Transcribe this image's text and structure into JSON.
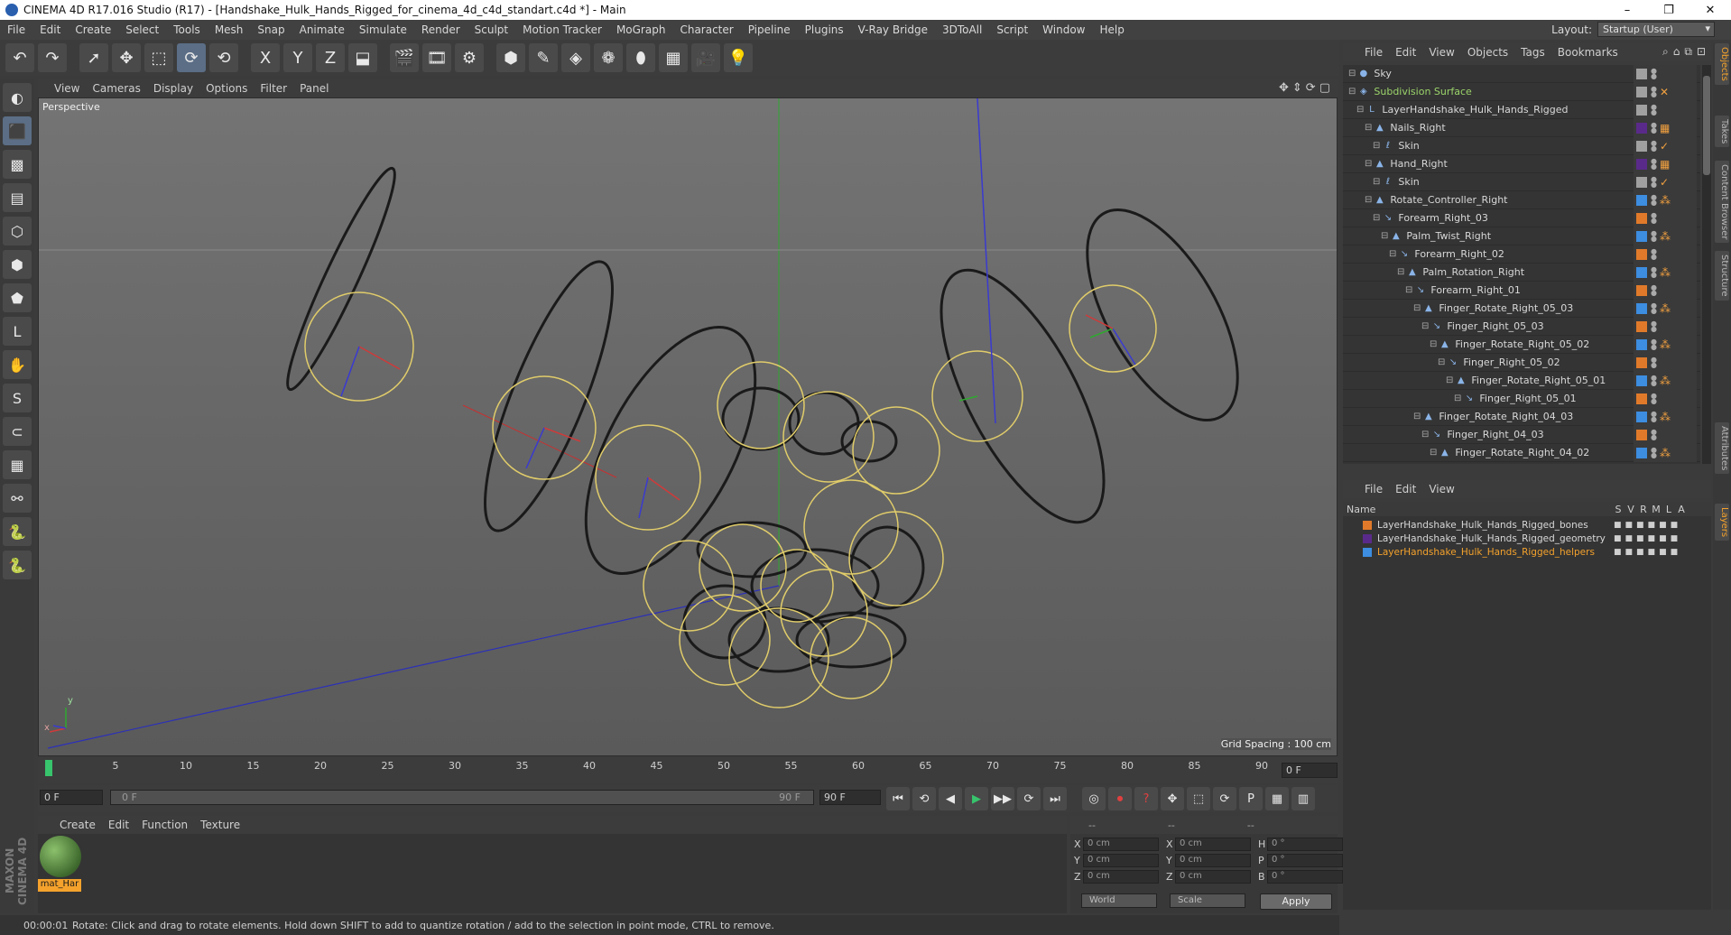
{
  "window": {
    "title": "CINEMA 4D R17.016 Studio (R17) - [Handshake_Hulk_Hands_Rigged_for_cinema_4d_c4d_standart.c4d *] - Main",
    "buttons": [
      "–",
      "❐",
      "✕"
    ]
  },
  "menubar": {
    "items": [
      "File",
      "Edit",
      "Create",
      "Select",
      "Tools",
      "Mesh",
      "Snap",
      "Animate",
      "Simulate",
      "Render",
      "Sculpt",
      "Motion Tracker",
      "MoGraph",
      "Character",
      "Pipeline",
      "Plugins",
      "V-Ray Bridge",
      "3DToAll",
      "Script",
      "Window",
      "Help"
    ],
    "layout_label": "Layout:",
    "layout_value": "Startup (User)"
  },
  "toolbar": {
    "icons": [
      "undo-icon",
      "redo-icon",
      "select-icon",
      "move-icon",
      "scale-icon",
      "rotate-icon",
      "recent-tool-icon",
      "x-axis-icon",
      "y-axis-icon",
      "z-axis-icon",
      "coord-system-icon",
      "render-view-icon",
      "render-picture-viewer-icon",
      "render-settings-icon",
      "cube-icon",
      "pen-icon",
      "subdivision-icon",
      "cloner-icon",
      "deformer-icon",
      "floor-icon",
      "camera-icon",
      "light-icon"
    ],
    "glyphs": [
      "↶",
      "↷",
      "➚",
      "✥",
      "⬚",
      "⟳",
      "⟲",
      "X",
      "Y",
      "Z",
      "⬓",
      "🎬",
      "🎞",
      "⚙",
      "⬢",
      "✎",
      "◈",
      "❁",
      "⬮",
      "▦",
      "🎥",
      "💡"
    ]
  },
  "lefttools": {
    "icons": [
      "make-editable-icon",
      "model-mode-icon",
      "texture-mode-icon",
      "workplane-icon",
      "points-mode-icon",
      "edges-mode-icon",
      "polygons-mode-icon",
      "axis-mode-icon",
      "tweak-icon",
      "solo-icon",
      "magnet-icon",
      "snap-icon",
      "lock-workplane-icon",
      "python-icon",
      "python-icon-2"
    ],
    "glyphs": [
      "◐",
      "⬛",
      "▩",
      "▤",
      "⬡",
      "⬢",
      "⬟",
      "L",
      "✋",
      "S",
      "⊂",
      "▦",
      "⚯",
      "🐍",
      "🐍"
    ],
    "logo": "MAXON CINEMA 4D"
  },
  "viewport": {
    "menu": [
      "View",
      "Cameras",
      "Display",
      "Options",
      "Filter",
      "Panel"
    ],
    "nav_icons": [
      "✥",
      "⇕",
      "⟳",
      "▢"
    ],
    "label": "Perspective",
    "grid_spacing": "Grid Spacing : 100 cm",
    "axis_x": "x",
    "axis_y": "y"
  },
  "timeline": {
    "ticks": [
      "0",
      "5",
      "10",
      "15",
      "20",
      "25",
      "30",
      "35",
      "40",
      "45",
      "50",
      "55",
      "60",
      "65",
      "70",
      "75",
      "80",
      "85",
      "90"
    ],
    "current_frame": "0 F"
  },
  "playback": {
    "start": "0 F",
    "range_start": "0 F",
    "range_end": "90 F",
    "end": "90 F",
    "buttons": [
      "⏮",
      "⟲",
      "◀",
      "▶",
      "▶▶",
      "⟳",
      "⏭"
    ],
    "key_buttons": [
      "◎",
      "⏺",
      "?",
      "✥",
      "⬚",
      "⟳",
      "P",
      "▦",
      "▥"
    ]
  },
  "material_manager": {
    "menu": [
      "Create",
      "Edit",
      "Function",
      "Texture"
    ],
    "material_name": "mat_Har"
  },
  "coordinates": {
    "head": [
      "--",
      "--",
      "--"
    ],
    "rows": [
      {
        "a": "X",
        "av": "0 cm",
        "b": "X",
        "bv": "0 cm",
        "c": "H",
        "cv": "0 °"
      },
      {
        "a": "Y",
        "av": "0 cm",
        "b": "Y",
        "bv": "0 cm",
        "c": "P",
        "cv": "0 °"
      },
      {
        "a": "Z",
        "av": "0 cm",
        "b": "Z",
        "bv": "0 cm",
        "c": "B",
        "cv": "0 °"
      }
    ],
    "world": "World",
    "scale": "Scale",
    "apply": "Apply"
  },
  "status": {
    "time": "00:00:01",
    "message": "Rotate: Click and drag to rotate elements. Hold down SHIFT to add to quantize rotation / add to the selection in point mode, CTRL to remove."
  },
  "object_manager": {
    "menu": [
      "File",
      "Edit",
      "View",
      "Objects",
      "Tags",
      "Bookmarks"
    ],
    "objects": [
      {
        "name": "Sky",
        "indent": 0,
        "icon": "●",
        "green": false,
        "swatch": "#a0a0a0",
        "tag": ""
      },
      {
        "name": "Subdivision Surface",
        "indent": 0,
        "icon": "◈",
        "green": true,
        "swatch": "#a0a0a0",
        "tag": "✕"
      },
      {
        "name": "LayerHandshake_Hulk_Hands_Rigged",
        "indent": 1,
        "icon": "L",
        "green": false,
        "swatch": "#a0a0a0",
        "tag": ""
      },
      {
        "name": "Nails_Right",
        "indent": 2,
        "icon": "▲",
        "green": false,
        "swatch": "#5a2a8a",
        "tag": "▦"
      },
      {
        "name": "Skin",
        "indent": 3,
        "icon": "ℓ",
        "green": false,
        "swatch": "#a0a0a0",
        "tag": "✓"
      },
      {
        "name": "Hand_Right",
        "indent": 2,
        "icon": "▲",
        "green": false,
        "swatch": "#5a2a8a",
        "tag": "▦"
      },
      {
        "name": "Skin",
        "indent": 3,
        "icon": "ℓ",
        "green": false,
        "swatch": "#a0a0a0",
        "tag": "✓"
      },
      {
        "name": "Rotate_Controller_Right",
        "indent": 2,
        "icon": "▲",
        "green": false,
        "swatch": "#3d8de0",
        "tag": "⁂"
      },
      {
        "name": "Forearm_Right_03",
        "indent": 3,
        "icon": "↘",
        "green": false,
        "swatch": "#e07a2a",
        "tag": ""
      },
      {
        "name": "Palm_Twist_Right",
        "indent": 4,
        "icon": "▲",
        "green": false,
        "swatch": "#3d8de0",
        "tag": "⁂"
      },
      {
        "name": "Forearm_Right_02",
        "indent": 5,
        "icon": "↘",
        "green": false,
        "swatch": "#e07a2a",
        "tag": ""
      },
      {
        "name": "Palm_Rotation_Right",
        "indent": 6,
        "icon": "▲",
        "green": false,
        "swatch": "#3d8de0",
        "tag": "⁂"
      },
      {
        "name": "Forearm_Right_01",
        "indent": 7,
        "icon": "↘",
        "green": false,
        "swatch": "#e07a2a",
        "tag": ""
      },
      {
        "name": "Finger_Rotate_Right_05_03",
        "indent": 8,
        "icon": "▲",
        "green": false,
        "swatch": "#3d8de0",
        "tag": "⁂"
      },
      {
        "name": "Finger_Right_05_03",
        "indent": 9,
        "icon": "↘",
        "green": false,
        "swatch": "#e07a2a",
        "tag": ""
      },
      {
        "name": "Finger_Rotate_Right_05_02",
        "indent": 10,
        "icon": "▲",
        "green": false,
        "swatch": "#3d8de0",
        "tag": "⁂"
      },
      {
        "name": "Finger_Right_05_02",
        "indent": 11,
        "icon": "↘",
        "green": false,
        "swatch": "#e07a2a",
        "tag": ""
      },
      {
        "name": "Finger_Rotate_Right_05_01",
        "indent": 12,
        "icon": "▲",
        "green": false,
        "swatch": "#3d8de0",
        "tag": "⁂"
      },
      {
        "name": "Finger_Right_05_01",
        "indent": 13,
        "icon": "↘",
        "green": false,
        "swatch": "#e07a2a",
        "tag": ""
      },
      {
        "name": "Finger_Rotate_Right_04_03",
        "indent": 8,
        "icon": "▲",
        "green": false,
        "swatch": "#3d8de0",
        "tag": "⁂"
      },
      {
        "name": "Finger_Right_04_03",
        "indent": 9,
        "icon": "↘",
        "green": false,
        "swatch": "#e07a2a",
        "tag": ""
      },
      {
        "name": "Finger_Rotate_Right_04_02",
        "indent": 10,
        "icon": "▲",
        "green": false,
        "swatch": "#3d8de0",
        "tag": "⁂"
      }
    ]
  },
  "layer_manager": {
    "menu": [
      "File",
      "Edit",
      "View"
    ],
    "columns": [
      "Name",
      "S",
      "V",
      "R",
      "M",
      "L",
      "A"
    ],
    "layers": [
      {
        "name": "LayerHandshake_Hulk_Hands_Rigged_bones",
        "color": "#e07a2a",
        "selected": false
      },
      {
        "name": "LayerHandshake_Hulk_Hands_Rigged_geometry",
        "color": "#5a2a8a",
        "selected": false
      },
      {
        "name": "LayerHandshake_Hulk_Hands_Rigged_helpers",
        "color": "#3d8de0",
        "selected": true
      }
    ]
  },
  "right_tabs": [
    "Objects",
    "Takes",
    "Content Browser",
    "Structure",
    "Attributes",
    "Layers"
  ]
}
